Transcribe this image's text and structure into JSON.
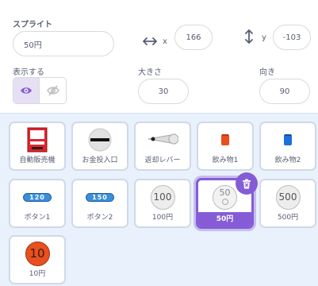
{
  "sprite_info": {
    "sprite_label": "スプライト",
    "sprite_name": "50円",
    "x_label": "x",
    "x_value": "166",
    "y_label": "y",
    "y_value": "-103",
    "show_label": "表示する",
    "size_label": "大きさ",
    "size_value": "30",
    "direction_label": "向き",
    "direction_value": "90",
    "visible": true
  },
  "sprites": [
    {
      "name": "自動販売機",
      "icon": "vending-machine-icon"
    },
    {
      "name": "お金投入口",
      "icon": "coin-slot-icon"
    },
    {
      "name": "返却レバー",
      "icon": "return-lever-icon"
    },
    {
      "name": "飲み物1",
      "icon": "drink-red-icon"
    },
    {
      "name": "飲み物2",
      "icon": "drink-blue-icon"
    },
    {
      "name": "ボタン1",
      "icon": "button-120-icon",
      "pill_text": "120"
    },
    {
      "name": "ボタン2",
      "icon": "button-150-icon",
      "pill_text": "150"
    },
    {
      "name": "100円",
      "icon": "coin-100-icon",
      "coin_text": "100"
    },
    {
      "name": "50円",
      "icon": "coin-50-icon",
      "coin_text": "50",
      "selected": true
    },
    {
      "name": "500円",
      "icon": "coin-500-icon",
      "coin_text": "500"
    },
    {
      "name": "10円",
      "icon": "coin-10-icon",
      "coin_text": "10"
    }
  ],
  "colors": {
    "accent": "#855cd6",
    "drink1": "#e8501e",
    "drink2": "#1e6fd9",
    "vending_red": "#e0242c",
    "coin10": "#e8501e"
  }
}
